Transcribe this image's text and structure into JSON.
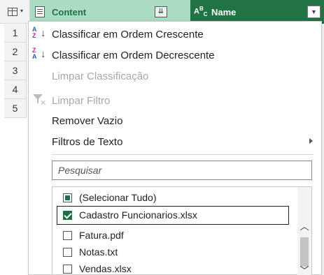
{
  "columns": [
    {
      "label": "Content"
    },
    {
      "label": "Name",
      "type_label": "ABC"
    }
  ],
  "row_numbers": [
    "1",
    "2",
    "3",
    "4",
    "5"
  ],
  "menu": {
    "sort_ascending": "Classificar em Ordem Crescente",
    "sort_descending": "Classificar em Ordem Decrescente",
    "clear_sort": "Limpar Classificação",
    "clear_filter": "Limpar Filtro",
    "remove_empty": "Remover Vazio",
    "text_filters": "Filtros de Texto",
    "search_placeholder": "Pesquisar",
    "filter_items": [
      {
        "label": "(Selecionar Tudo)",
        "state": "partial"
      },
      {
        "label": "Cadastro Funcionarios.xlsx",
        "state": "checked"
      },
      {
        "label": "Fatura.pdf",
        "state": "unchecked"
      },
      {
        "label": "Notas.txt",
        "state": "unchecked"
      },
      {
        "label": "Vendas.xlsx",
        "state": "unchecked"
      }
    ]
  },
  "colors": {
    "name_header_bg": "#217346",
    "content_header_bg": "#a9dcc3",
    "checkbox_accent": "#1f6e45"
  }
}
